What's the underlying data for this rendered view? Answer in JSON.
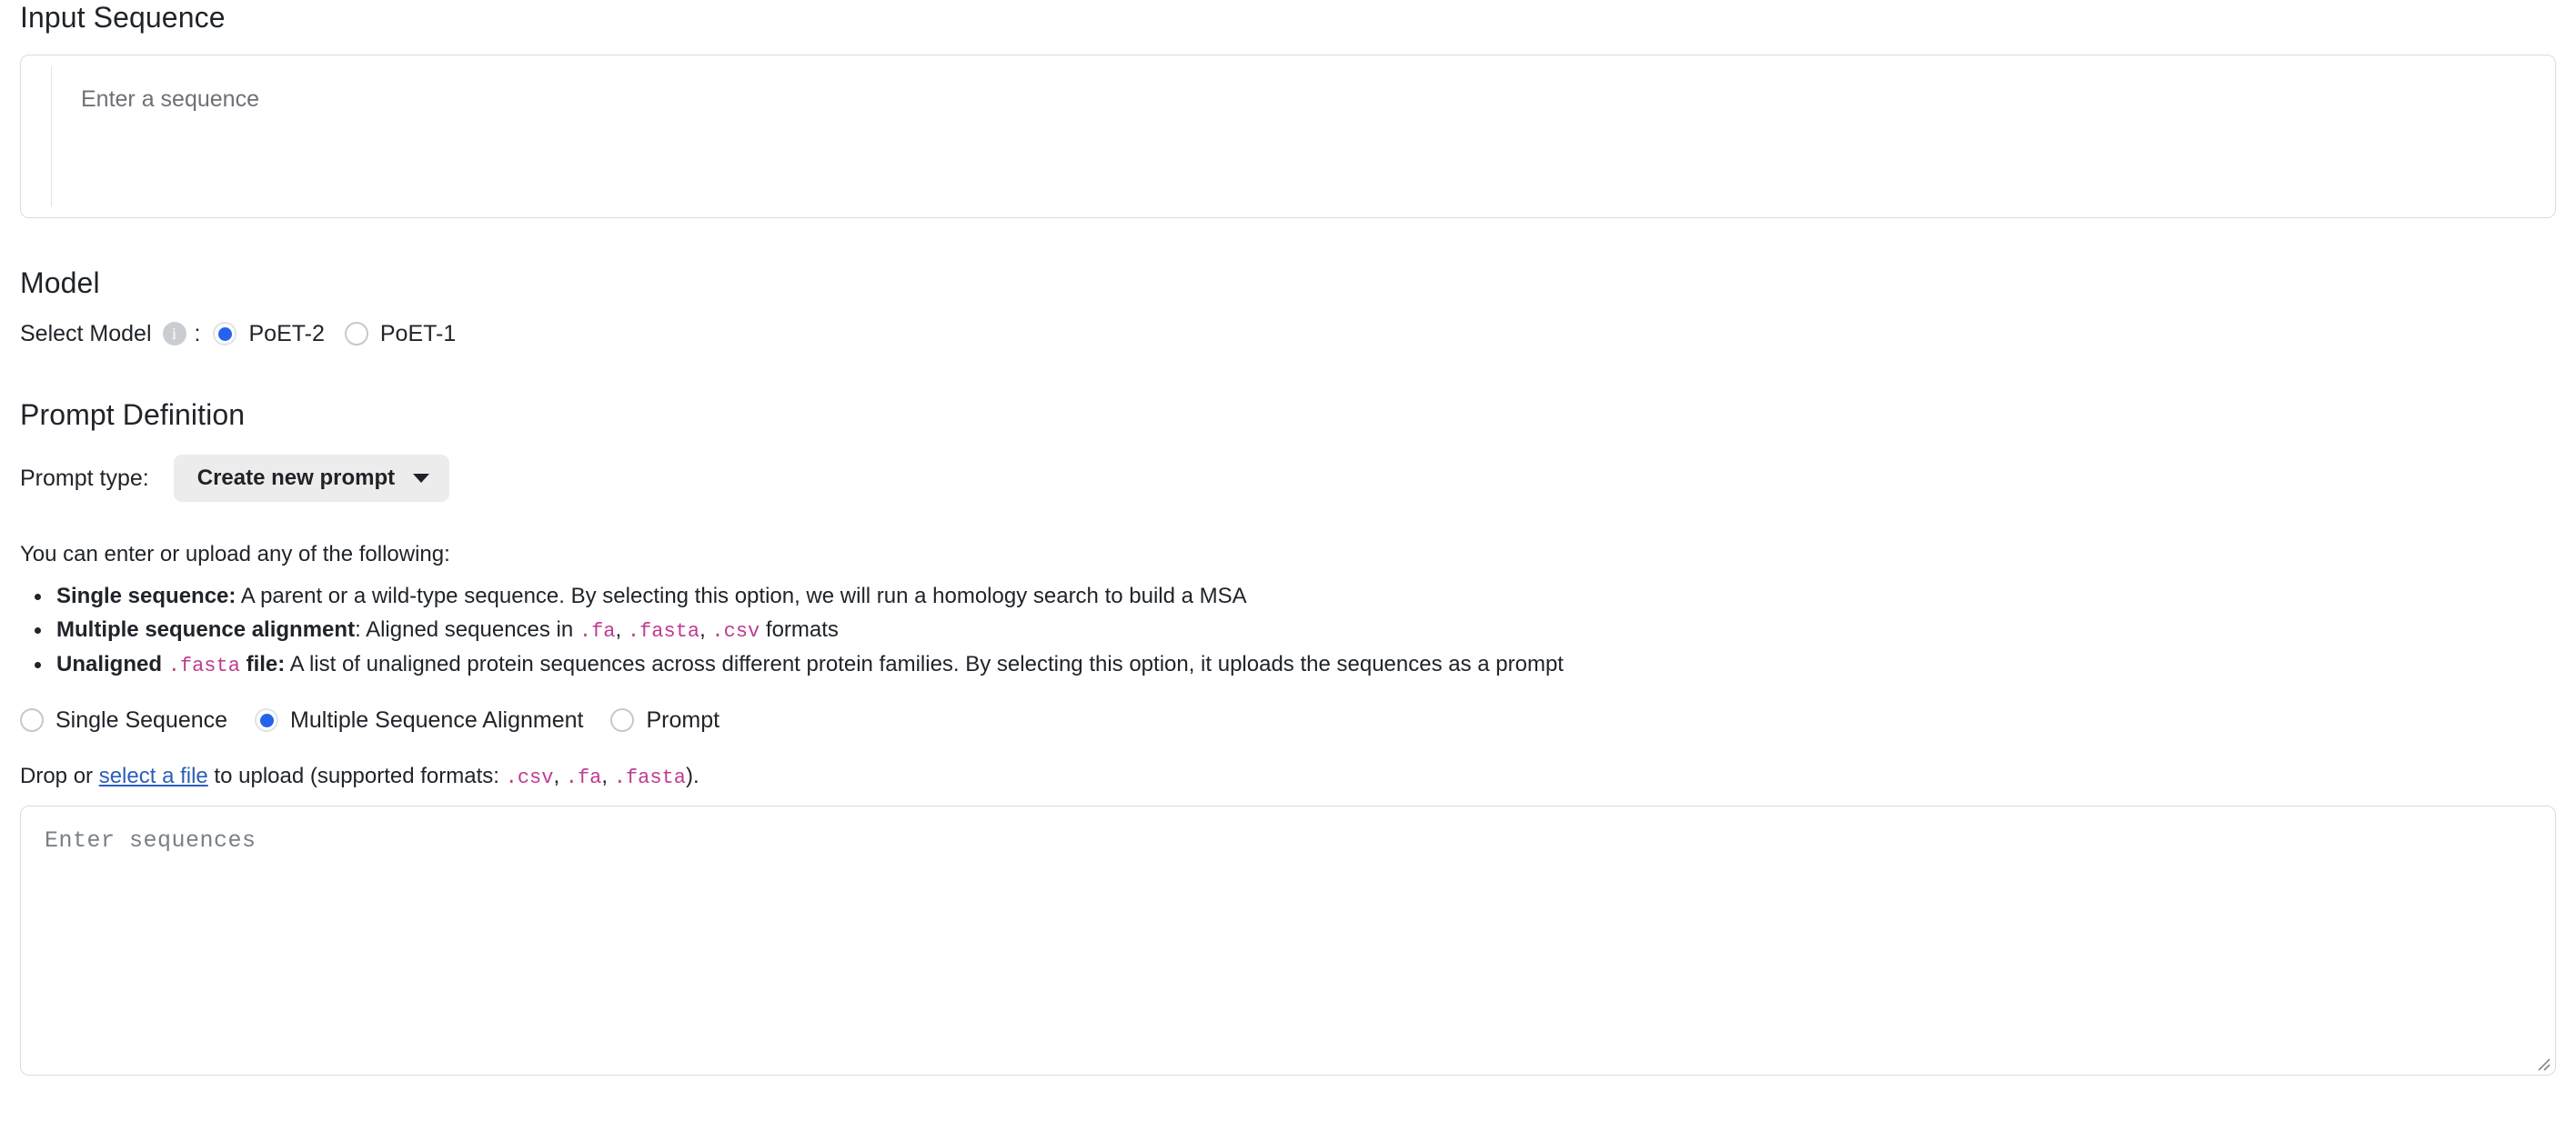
{
  "input_sequence": {
    "heading": "Input Sequence",
    "placeholder": "Enter a sequence",
    "value": ""
  },
  "model": {
    "heading": "Model",
    "select_label": "Select Model",
    "info_icon_glyph": "i",
    "info_icon_name": "info-icon",
    "colon": ":",
    "options": [
      {
        "label": "PoET-2",
        "selected": true
      },
      {
        "label": "PoET-1",
        "selected": false
      }
    ]
  },
  "prompt_definition": {
    "heading": "Prompt Definition",
    "prompt_type_label": "Prompt type:",
    "prompt_type_value": "Create new prompt",
    "prompt_type_chevron": "chevron-down-icon",
    "description_intro": "You can enter or upload any of the following:",
    "bullets": [
      {
        "bold": "Single sequence:",
        "text": " A parent or a wild-type sequence. By selecting this option, we will run a homology search to build a MSA"
      },
      {
        "bold": "Multiple sequence alignment",
        "text_before_code": ": Aligned sequences in ",
        "codes": [
          ".fa",
          ".fasta",
          ".csv"
        ],
        "text_after_code": " formats"
      },
      {
        "bold_1": "Unaligned",
        "code": ".fasta",
        "bold_2": "file:",
        "text": " A list of unaligned protein sequences across different protein families. By selecting this option, it uploads the sequences as a prompt"
      }
    ],
    "source_options": [
      {
        "label": "Single Sequence",
        "selected": false
      },
      {
        "label": "Multiple Sequence Alignment",
        "selected": true
      },
      {
        "label": "Prompt",
        "selected": false
      }
    ],
    "upload": {
      "prefix": "Drop or ",
      "link": "select a file",
      "middle": " to upload (supported formats: ",
      "formats": [
        ".csv",
        ".fa",
        ".fasta"
      ],
      "suffix": ")."
    },
    "sequences_placeholder": "Enter sequences",
    "sequences_value": ""
  },
  "colors": {
    "accent_blue": "#2563eb",
    "link_blue": "#2c5fb8",
    "code_magenta": "#bf3b8f",
    "text_primary": "#20242a",
    "placeholder_gray": "#6d7176",
    "button_gray": "#ececec",
    "border_gray": "#d7dde2"
  }
}
